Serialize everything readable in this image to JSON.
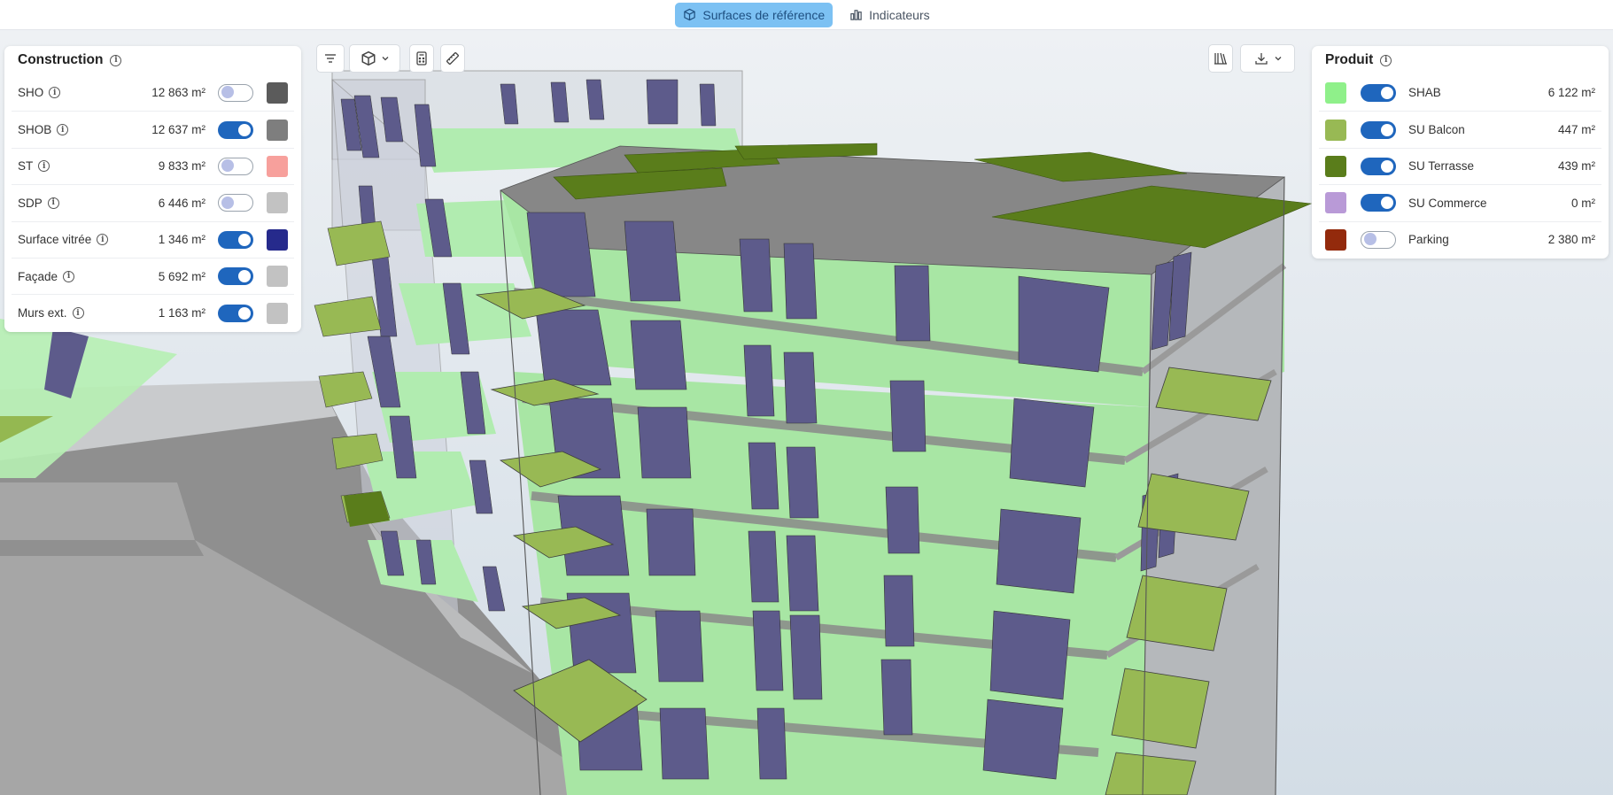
{
  "tabs": [
    {
      "label": "Surfaces de référence",
      "active": true,
      "icon": "cube-icon"
    },
    {
      "label": "Indicateurs",
      "active": false,
      "icon": "bar-chart-icon"
    }
  ],
  "toolbar": {
    "left": [
      "filter-icon",
      "cube-view-icon",
      "calculator-icon",
      "ruler-icon"
    ],
    "right": [
      "library-icon",
      "download-icon"
    ]
  },
  "construction": {
    "title": "Construction",
    "rows": [
      {
        "label": "SHO",
        "value": "12 863 m²",
        "on": false,
        "color": "#5b5b5b"
      },
      {
        "label": "SHOB",
        "value": "12 637 m²",
        "on": true,
        "color": "#7e7e7e"
      },
      {
        "label": "ST",
        "value": "9 833 m²",
        "on": false,
        "color": "#f7a09c"
      },
      {
        "label": "SDP",
        "value": "6 446 m²",
        "on": false,
        "color": "#c2c2c2"
      },
      {
        "label": "Surface vitrée",
        "value": "1 346 m²",
        "on": true,
        "color": "#262a8c"
      },
      {
        "label": "Façade",
        "value": "5 692 m²",
        "on": true,
        "color": "#c2c2c2"
      },
      {
        "label": "Murs ext.",
        "value": "1 163 m²",
        "on": true,
        "color": "#c2c2c2"
      }
    ]
  },
  "produit": {
    "title": "Produit",
    "rows": [
      {
        "label": "SHAB",
        "value": "6 122 m²",
        "on": true,
        "color": "#8ff08a"
      },
      {
        "label": "SU Balcon",
        "value": "447 m²",
        "on": true,
        "color": "#98b954"
      },
      {
        "label": "SU Terrasse",
        "value": "439 m²",
        "on": true,
        "color": "#5a7d1b"
      },
      {
        "label": "SU Commerce",
        "value": "0 m²",
        "on": true,
        "color": "#b99ad7"
      },
      {
        "label": "Parking",
        "value": "2 380 m²",
        "on": false,
        "color": "#932a0c"
      }
    ]
  }
}
